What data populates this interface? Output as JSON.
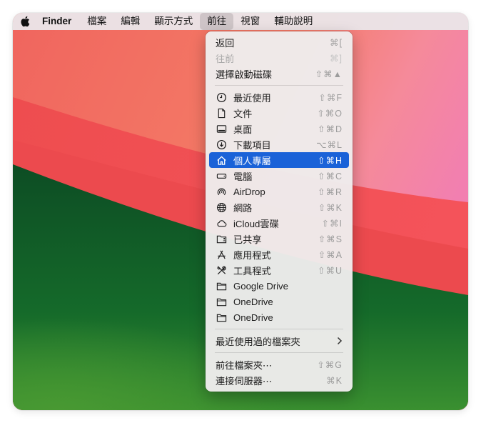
{
  "menubar": {
    "app_name": "Finder",
    "items": [
      "檔案",
      "編輯",
      "顯示方式",
      "前往",
      "視窗",
      "輔助說明"
    ]
  },
  "go_menu": {
    "nav": [
      {
        "label": "返回",
        "shortcut": "⌘[",
        "disabled": false
      },
      {
        "label": "往前",
        "shortcut": "⌘]",
        "disabled": true
      },
      {
        "label": "選擇啟動磁碟",
        "shortcut": "⇧⌘▲",
        "disabled": false
      }
    ],
    "places": [
      {
        "label": "最近使用",
        "shortcut": "⇧⌘F",
        "icon": "clock-icon"
      },
      {
        "label": "文件",
        "shortcut": "⇧⌘O",
        "icon": "document-icon"
      },
      {
        "label": "桌面",
        "shortcut": "⇧⌘D",
        "icon": "desktop-icon"
      },
      {
        "label": "下載項目",
        "shortcut": "⌥⌘L",
        "icon": "download-icon"
      },
      {
        "label": "個人專屬",
        "shortcut": "⇧⌘H",
        "icon": "home-icon"
      },
      {
        "label": "電腦",
        "shortcut": "⇧⌘C",
        "icon": "computer-icon"
      },
      {
        "label": "AirDrop",
        "shortcut": "⇧⌘R",
        "icon": "airdrop-icon"
      },
      {
        "label": "網路",
        "shortcut": "⇧⌘K",
        "icon": "globe-icon"
      },
      {
        "label": "iCloud雲碟",
        "shortcut": "⇧⌘I",
        "icon": "cloud-icon"
      },
      {
        "label": "已共享",
        "shortcut": "⇧⌘S",
        "icon": "shared-folder-icon"
      },
      {
        "label": "應用程式",
        "shortcut": "⇧⌘A",
        "icon": "applications-icon"
      },
      {
        "label": "工具程式",
        "shortcut": "⇧⌘U",
        "icon": "utilities-icon"
      },
      {
        "label": "Google Drive",
        "shortcut": "",
        "icon": "folder-icon"
      },
      {
        "label": "OneDrive",
        "shortcut": "",
        "icon": "folder-icon"
      },
      {
        "label": "OneDrive",
        "shortcut": "",
        "icon": "folder-icon"
      }
    ],
    "recent_folders": {
      "label": "最近使用過的檔案夾",
      "icon": "chevron-right-icon"
    },
    "actions": [
      {
        "label": "前往檔案夾⋯",
        "shortcut": "⇧⌘G"
      },
      {
        "label": "連接伺服器⋯",
        "shortcut": "⌘K"
      }
    ],
    "highlight_color": "#1a62d8"
  }
}
